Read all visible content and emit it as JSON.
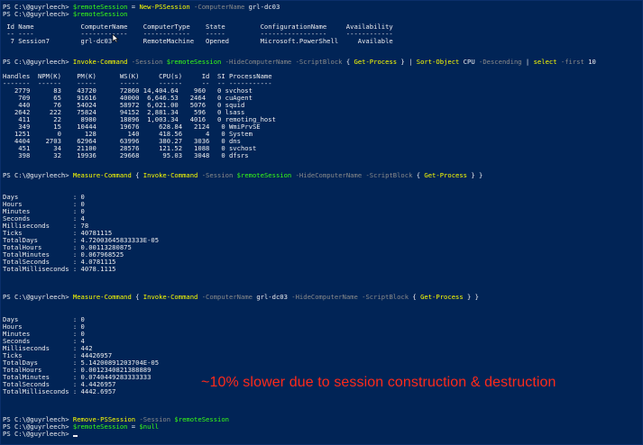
{
  "prompt": "PS C:\\@guyrleech> ",
  "lines": {
    "l1": {
      "var": "$remoteSession",
      "op": " = ",
      "cmd": "New-PSSession",
      "param": " -ComputerName ",
      "arg": "grl-dc03"
    },
    "l2": {
      "var": "$remoteSession"
    },
    "session_table": {
      "header": " Id Name            ComputerName    ComputerType    State         ConfigurationName     Availability",
      "underline": " -- ----            ------------    ------------    -----         -----------------     ------------",
      "row": "  7 Session7        grl-dc03        RemoteMachine   Opened        Microsoft.PowerShell     Available"
    },
    "l_invoke": {
      "cmd1": "Invoke-Command",
      "p1": " -Session ",
      "v1": "$remoteSession",
      "p2": " -HideComputerName -ScriptBlock ",
      "b1": "{ ",
      "cmd2": "Get-Process",
      "b2": " } | ",
      "cmd3": "Sort-Object",
      "a3": " CPU ",
      "p3": "-Descending",
      "pipe": " | ",
      "cmd4": "select",
      "p4": " -first ",
      "a4": "10"
    },
    "process_table": {
      "header": "Handles  NPM(K)    PM(K)      WS(K)     CPU(s)     Id  SI ProcessName",
      "underline": "-------  ------    -----      -----     ------     --  -- -----------",
      "rows": [
        "   2779      83    43720      72860 14,404.64    960   0 svchost",
        "    709      65    91616      40000  6,646.53   2464   0 cuAgent",
        "    440      76    54024      58972  6,021.00   5076   0 squid",
        "   2642     222    75824      94152  2,881.34    596   0 lsass",
        "    411      22     8980      18896  1,003.34   4016   0 remoting_host",
        "    349      15    10444      19676     628.84   2124   0 WmiPrvSE",
        "   1251       0      128        140     418.56      4   0 System",
        "   4404    2703    62964      63996     380.27   3036   0 dns",
        "    451      34    21100      28576     121.52   1088   0 svchost",
        "    398      32    19936      29668      95.03   3048   0 dfsrs"
      ]
    },
    "l_measure1": {
      "cmd1": "Measure-Command",
      "b1": " { ",
      "cmd2": "Invoke-Command",
      "p1": " -Session ",
      "v1": "$remoteSession",
      "p2": " -HideComputerName -ScriptBlock ",
      "b2": "{ ",
      "cmd3": "Get-Process",
      "b3": " } }"
    },
    "measure1": [
      "Days              : 0",
      "Hours             : 0",
      "Minutes           : 0",
      "Seconds           : 4",
      "Milliseconds      : 78",
      "Ticks             : 40781115",
      "TotalDays         : 4.72003645833333E-05",
      "TotalHours        : 0.00113280875",
      "TotalMinutes      : 0.067968525",
      "TotalSeconds      : 4.0781115",
      "TotalMilliseconds : 4078.1115"
    ],
    "l_measure2": {
      "cmd1": "Measure-Command",
      "b1": " { ",
      "cmd2": "Invoke-Command",
      "p1": " -ComputerName ",
      "a1": "grl-dc03",
      "p2": " -HideComputerName -ScriptBlock ",
      "b2": "{ ",
      "cmd3": "Get-Process",
      "b3": " } }"
    },
    "measure2": [
      "Days              : 0",
      "Hours             : 0",
      "Minutes           : 0",
      "Seconds           : 4",
      "Milliseconds      : 442",
      "Ticks             : 44426957",
      "TotalDays         : 5.14200891203704E-05",
      "TotalHours        : 0.0012340821388889",
      "TotalMinutes      : 0.0740449283333333",
      "TotalSeconds      : 4.4426957",
      "TotalMilliseconds : 4442.6957"
    ],
    "l_remove": {
      "cmd": "Remove-PSSession",
      "param": " -Session ",
      "var": "$remoteSession"
    },
    "l_null": {
      "var": "$remoteSession",
      "op": " = ",
      "var2": "$null"
    }
  },
  "callout": "~10% slower due to session construction & destruction",
  "colors": {
    "background": "#012456",
    "command": "#ffff00",
    "parameter": "#8a8a8a",
    "variable": "#39ff14",
    "text": "#eeedf0",
    "callout": "#ff2a1a"
  }
}
